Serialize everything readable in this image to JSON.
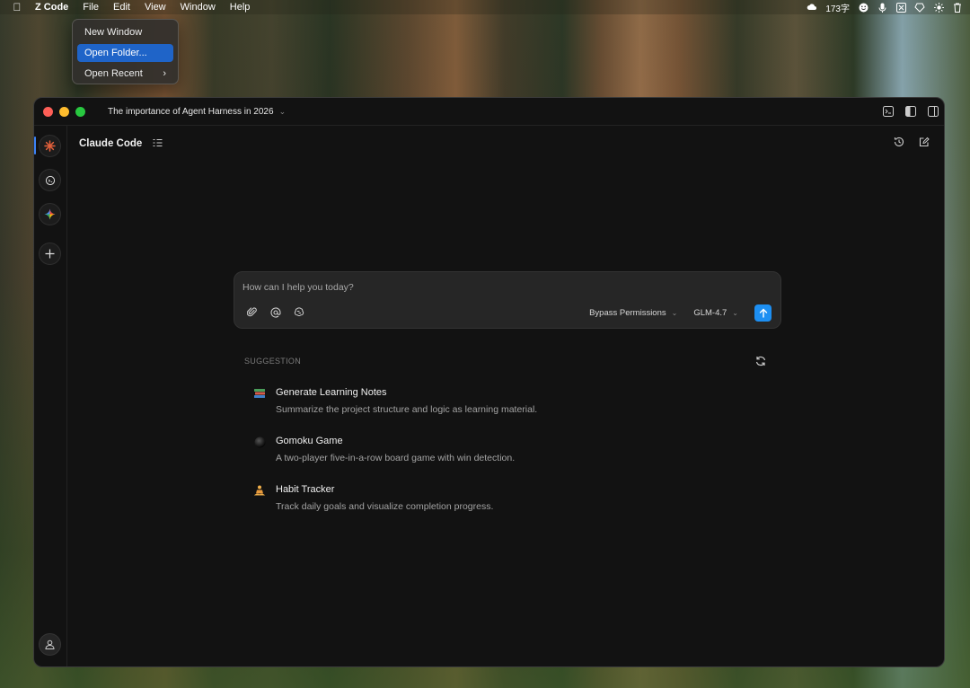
{
  "menubar": {
    "app_name": "Z Code",
    "items": [
      "File",
      "Edit",
      "View",
      "Window",
      "Help"
    ],
    "status_text": "173字"
  },
  "file_menu": {
    "items": [
      {
        "label": "New Window"
      },
      {
        "label": "Open Folder..."
      },
      {
        "label": "Open Recent"
      }
    ]
  },
  "window": {
    "title": "The importance of Agent Harness in 2026"
  },
  "header": {
    "title": "Claude Code"
  },
  "prompt": {
    "placeholder": "How can I help you today?",
    "permission_mode": "Bypass Permissions",
    "model": "GLM-4.7"
  },
  "suggestions": {
    "label": "SUGGESTION",
    "items": [
      {
        "icon": "books-icon",
        "title": "Generate Learning Notes",
        "description": "Summarize the project structure and logic as learning material."
      },
      {
        "icon": "black-circle-icon",
        "title": "Gomoku Game",
        "description": "A two-player five-in-a-row board game with win detection."
      },
      {
        "icon": "meditation-icon",
        "title": "Habit Tracker",
        "description": "Track daily goals and visualize completion progress."
      }
    ]
  },
  "colors": {
    "accent": "#1d8ff2",
    "menu_highlight": "#1f64c8",
    "window_bg": "#121212"
  }
}
